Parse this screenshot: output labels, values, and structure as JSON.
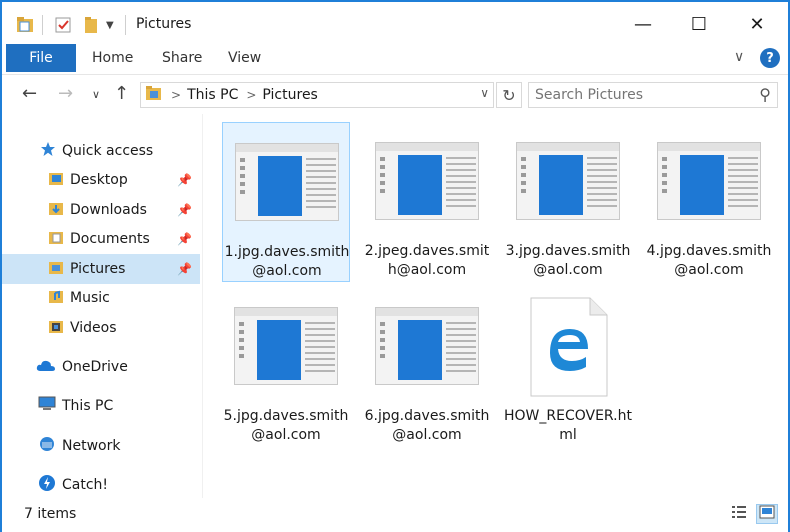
{
  "window": {
    "title": "Pictures",
    "minimize_glyph": "—",
    "maximize_glyph": "☐",
    "close_glyph": "✕"
  },
  "ribbon": {
    "tabs": [
      "File",
      "Home",
      "Share",
      "View"
    ],
    "collapse_glyph": "∨",
    "help_glyph": "?"
  },
  "address": {
    "crumbs": [
      "This PC",
      "Pictures"
    ],
    "search_placeholder": "Search Pictures"
  },
  "sidebar": {
    "items": [
      {
        "label": "Quick access",
        "icon": "star-icon",
        "pinned": false
      },
      {
        "label": "Desktop",
        "icon": "folder-icon",
        "pinned": true
      },
      {
        "label": "Downloads",
        "icon": "folder-icon",
        "pinned": true
      },
      {
        "label": "Documents",
        "icon": "folder-icon",
        "pinned": true
      },
      {
        "label": "Pictures",
        "icon": "folder-icon",
        "pinned": true,
        "selected": true
      },
      {
        "label": "Music",
        "icon": "folder-icon",
        "pinned": false
      },
      {
        "label": "Videos",
        "icon": "folder-icon",
        "pinned": false
      },
      {
        "label": "OneDrive",
        "icon": "cloud-icon",
        "pinned": false
      },
      {
        "label": "This PC",
        "icon": "computer-icon",
        "pinned": false
      },
      {
        "label": "Network",
        "icon": "network-icon",
        "pinned": false
      },
      {
        "label": "Catch!",
        "icon": "catch-icon",
        "pinned": false
      }
    ]
  },
  "files": [
    {
      "name": "1.jpg.daves.smith@aol.com",
      "type": "image",
      "selected": true
    },
    {
      "name": "2.jpeg.daves.smith@aol.com",
      "type": "image"
    },
    {
      "name": "3.jpg.daves.smith@aol.com",
      "type": "image"
    },
    {
      "name": "4.jpg.daves.smith@aol.com",
      "type": "image"
    },
    {
      "name": "5.jpg.daves.smith@aol.com",
      "type": "image"
    },
    {
      "name": "6.jpg.daves.smith@aol.com",
      "type": "image"
    },
    {
      "name": "HOW_RECOVER.html",
      "type": "html"
    }
  ],
  "status": {
    "item_count": "7 items"
  },
  "colors": {
    "accent": "#1f6fc0",
    "selection": "#cce4f7",
    "thumb_blue": "#1e78d4",
    "edge_blue": "#1e88d6"
  }
}
